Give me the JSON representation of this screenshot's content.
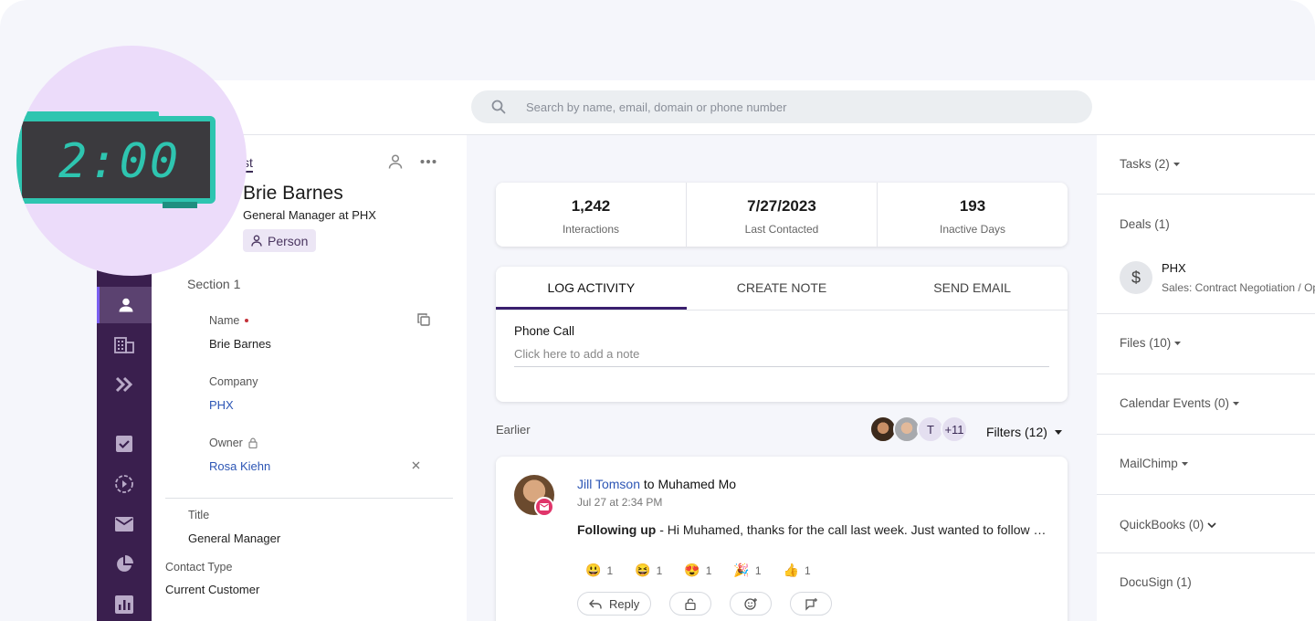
{
  "search": {
    "placeholder": "Search by name, email, domain or phone number"
  },
  "timer": {
    "display": "2:00"
  },
  "contact": {
    "tab_label": "st",
    "name": "Brie Barnes",
    "subtitle": "General Manager at PHX",
    "type_chip": "Person"
  },
  "section": {
    "title": "Section 1",
    "fields": {
      "name_label": "Name",
      "name_value": "Brie Barnes",
      "company_label": "Company",
      "company_value": "PHX",
      "owner_label": "Owner",
      "owner_value": "Rosa Kiehn",
      "title_label": "Title",
      "title_value": "General Manager",
      "contact_type_label": "Contact Type",
      "contact_type_value": "Current Customer"
    }
  },
  "stats": [
    {
      "value": "1,242",
      "label": "Interactions"
    },
    {
      "value": "7/27/2023",
      "label": "Last Contacted"
    },
    {
      "value": "193",
      "label": "Inactive Days"
    }
  ],
  "activity": {
    "tabs": [
      "LOG ACTIVITY",
      "CREATE NOTE",
      "SEND EMAIL"
    ],
    "type": "Phone Call",
    "note_placeholder": "Click here to add a note"
  },
  "feed": {
    "earlier_label": "Earlier",
    "avatar_letter": "T",
    "avatar_more": "+11",
    "filters_label": "Filters (12)",
    "item": {
      "from": "Jill Tomson",
      "to_text": " to Muhamed Mo",
      "time": "Jul 27 at 2:34 PM",
      "subject": "Following up",
      "preview": " - Hi Muhamed, thanks for the call last week. Just wanted to follow up on the proposal we discussed",
      "reactions": [
        {
          "emoji": "😃",
          "count": "1"
        },
        {
          "emoji": "😆",
          "count": "1"
        },
        {
          "emoji": "😍",
          "count": "1"
        },
        {
          "emoji": "🎉",
          "count": "1"
        },
        {
          "emoji": "👍",
          "count": "1"
        }
      ],
      "reply_label": "Reply"
    }
  },
  "right_panel": {
    "tasks": "Tasks (2)",
    "deals": "Deals (1)",
    "deal_name": "PHX",
    "deal_stage": "Sales: Contract Negotiation / Op",
    "files": "Files (10)",
    "calendar": "Calendar Events (0)",
    "mailchimp": "MailChimp",
    "quickbooks": "QuickBooks (0)",
    "docusign": "DocuSign (1)"
  },
  "colors": {
    "sidebar": "#3a1f4e",
    "accent": "#3a1f6e",
    "link": "#2d56b5",
    "timer": "#2ec5b0"
  }
}
